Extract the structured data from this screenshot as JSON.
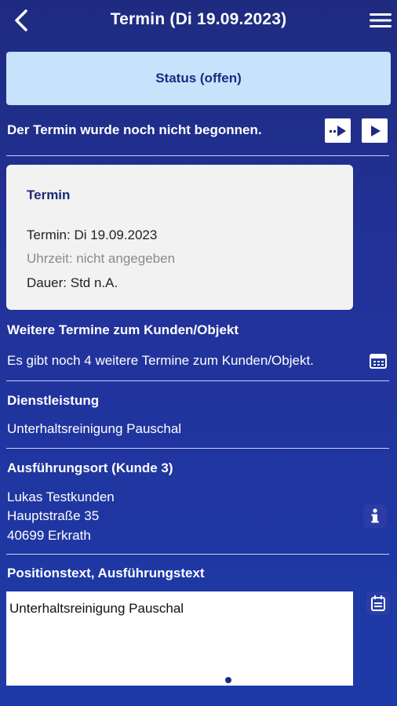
{
  "header": {
    "title": "Termin (Di 19.09.2023)"
  },
  "status": {
    "label": "Status (offen)",
    "message": "Der Termin wurde noch nicht begonnen."
  },
  "termin_card": {
    "title": "Termin",
    "date": "Termin: Di 19.09.2023",
    "time": "Uhrzeit: nicht angegeben",
    "duration": "Dauer: Std n.A."
  },
  "weitere_termine": {
    "title": "Weitere Termine zum Kunden/Objekt",
    "text": "Es gibt noch 4 weitere Termine zum Kunden/Objekt."
  },
  "dienstleistung": {
    "title": "Dienstleistung",
    "text": "Unterhaltsreinigung Pauschal"
  },
  "ausfuehrungsort": {
    "title": "Ausführungsort (Kunde 3)",
    "name": "Lukas Testkunden",
    "street": "Hauptstraße 35",
    "city": "40699 Erkrath"
  },
  "positionstext": {
    "title": "Positionstext, Ausführungstext",
    "value": "Unterhaltsreinigung Pauschal"
  },
  "icons": {
    "back": "chevron-left-icon",
    "menu": "hamburger-menu-icon",
    "skip_play": "skip-play-icon",
    "play": "play-icon",
    "calendar": "calendar-icon",
    "info": "info-icon"
  },
  "colors": {
    "background": "#22329a",
    "status_box": "#c6e3fb",
    "card": "#f2f2f2",
    "accent_text": "#1e2a78"
  }
}
